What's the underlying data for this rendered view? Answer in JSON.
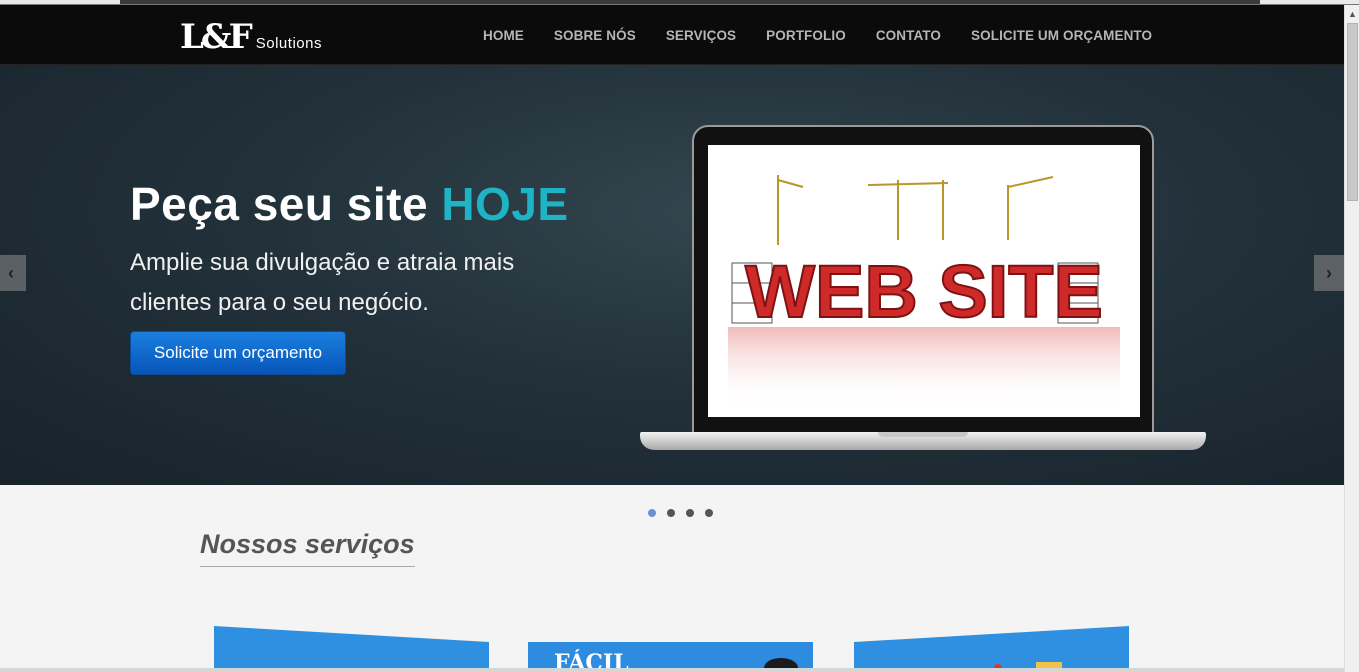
{
  "brand": {
    "mark": "L&F",
    "name": "Solutions"
  },
  "nav": {
    "items": [
      "HOME",
      "SOBRE NÓS",
      "SERVIÇOS",
      "PORTFOLIO",
      "CONTATO",
      "SOLICITE UM ORÇAMENTO"
    ]
  },
  "hero": {
    "title": "Peça seu site ",
    "title_accent": "HOJE",
    "subtitle": "Amplie sua divulgação e atraia mais clientes para o seu negócio.",
    "button": "Solicite um orçamento",
    "arrow_left": "‹",
    "arrow_right": "›",
    "image_text": "WEB SITE"
  },
  "carousel": {
    "slides": 4,
    "active": 0
  },
  "services": {
    "title": "Nossos serviços",
    "cards": [
      "",
      "FÁCIL",
      ""
    ]
  },
  "colors": {
    "accent": "#1fb3c6",
    "button": "#0b63c8",
    "navbar": "#0b0b0b",
    "card": "#2f8fe0"
  }
}
